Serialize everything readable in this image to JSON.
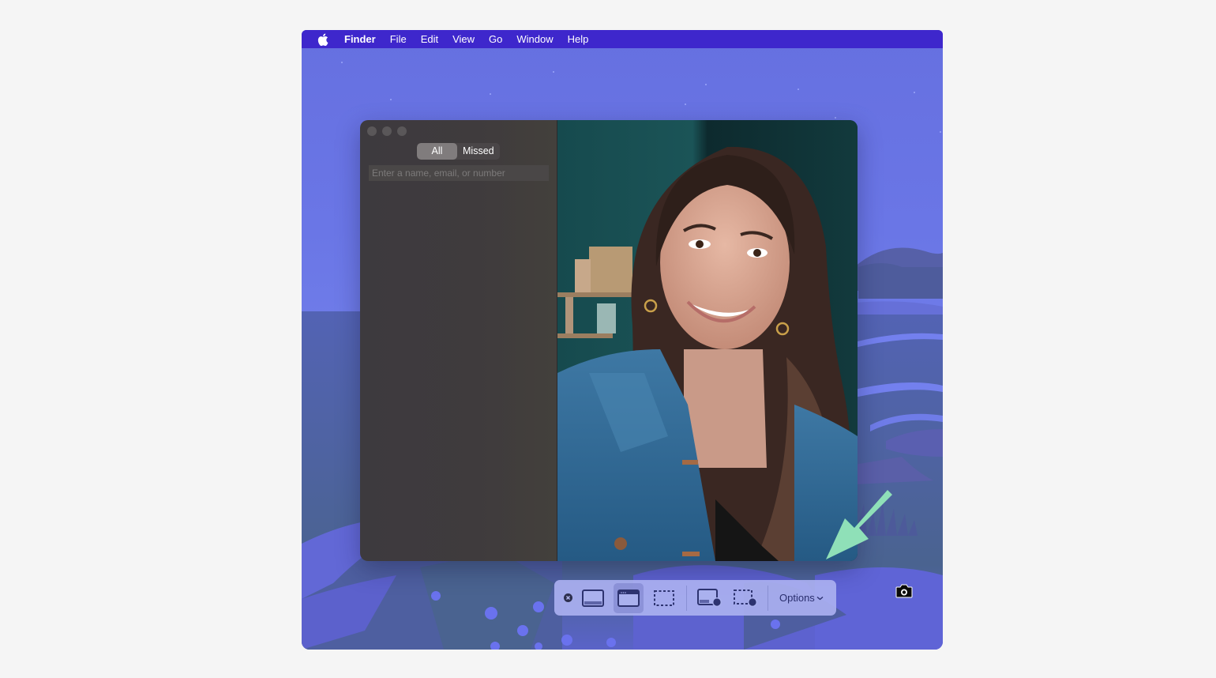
{
  "menubar": {
    "apple_icon": "apple-logo-icon",
    "app_name": "Finder",
    "items": [
      "File",
      "Edit",
      "View",
      "Go",
      "Window",
      "Help"
    ],
    "bg_color": "#3e27cc"
  },
  "facetime_window": {
    "segmented_control": {
      "options": [
        "All",
        "Missed"
      ],
      "selected": "All"
    },
    "search": {
      "value": "",
      "placeholder": "Enter a name, email, or number"
    },
    "video_preview": "front-camera-feed-person"
  },
  "screenshot_toolbar": {
    "buttons": [
      {
        "icon": "close-icon",
        "label": "Close"
      },
      {
        "icon": "capture-entire-screen-icon",
        "label": "Capture Entire Screen"
      },
      {
        "icon": "capture-selected-window-icon",
        "label": "Capture Selected Window",
        "selected": true
      },
      {
        "icon": "capture-selected-portion-icon",
        "label": "Capture Selected Portion"
      },
      {
        "icon": "record-entire-screen-icon",
        "label": "Record Entire Screen"
      },
      {
        "icon": "record-selected-portion-icon",
        "label": "Record Selected Portion"
      }
    ],
    "options_label": "Options",
    "options_icon": "chevron-down-icon"
  },
  "window_capture_cursor": "camera-icon",
  "annotation": {
    "type": "arrow",
    "color": "#8fe0b8",
    "points_to": "facetime-window-bottom-right"
  }
}
